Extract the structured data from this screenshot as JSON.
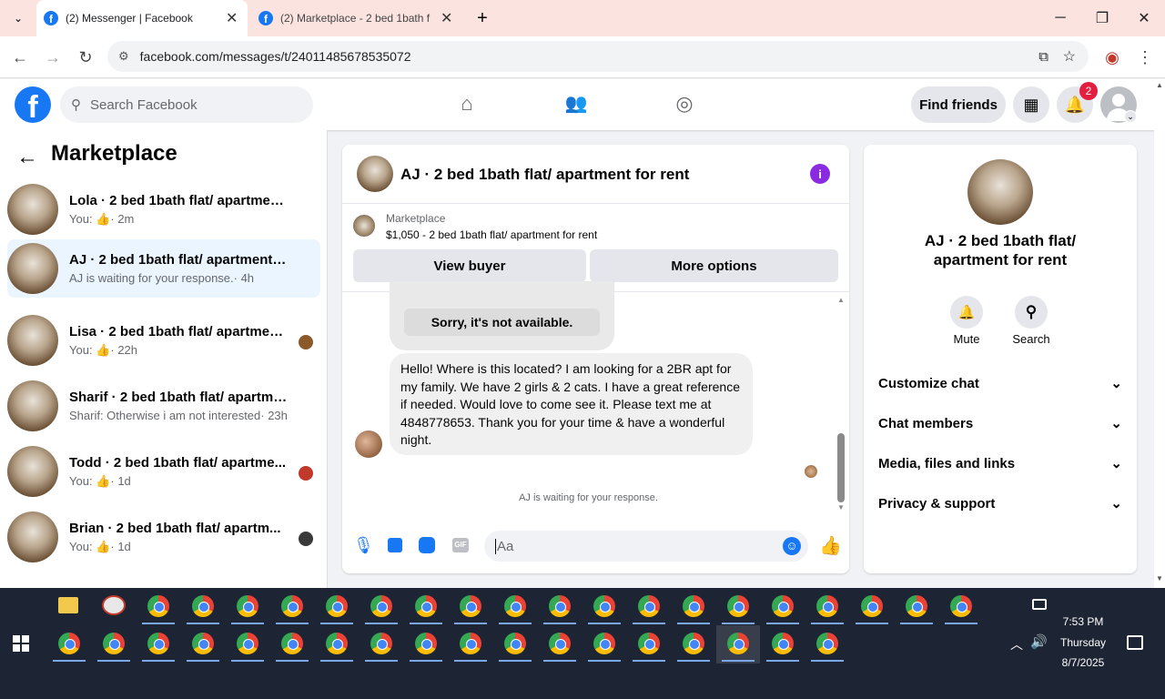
{
  "browser": {
    "tabs": [
      {
        "title": "(2) Messenger | Facebook"
      },
      {
        "title": "(2) Marketplace - 2 bed 1bath f"
      }
    ],
    "url": "facebook.com/messages/t/24011485678535072"
  },
  "fb": {
    "search_placeholder": "Search Facebook",
    "find_friends": "Find friends",
    "notif_count": "2"
  },
  "sidebar": {
    "title": "Marketplace",
    "conversations": [
      {
        "title": "Lola · 2 bed 1bath flat/ apartment ...",
        "prefix": "You:",
        "time": "· 2m"
      },
      {
        "title": "AJ · 2 bed 1bath flat/ apartment fo...",
        "prefix": "AJ is waiting for your response.",
        "time": "· 4h"
      },
      {
        "title": "Lisa · 2 bed 1bath flat/ apartmen...",
        "prefix": "You:",
        "time": "· 22h"
      },
      {
        "title": "Sharif · 2 bed 1bath flat/ apartmen...",
        "prefix": "Sharif: Otherwise i am not interested",
        "time": "· 23h"
      },
      {
        "title": "Todd · 2 bed 1bath flat/ apartme...",
        "prefix": "You:",
        "time": "· 1d"
      },
      {
        "title": "Brian · 2 bed 1bath flat/ apartm...",
        "prefix": "You:",
        "time": "· 1d"
      }
    ]
  },
  "chat": {
    "title": "AJ · 2 bed 1bath flat/ apartment for rent",
    "listing_source": "Marketplace",
    "listing_title": "$1,050 - 2 bed 1bath flat/ apartment for rent",
    "view_buyer": "View buyer",
    "more_options": "More options",
    "reply_option": "Sorry, it's not available.",
    "message": "Hello! Where is this located? I am looking for a 2BR apt for my family. We have 2 girls & 2 cats. I have a great reference if needed. Would love to come see it. Please text me at 4848778653. Thank you for your time & have a wonderful night.",
    "waiting": "AJ is waiting for your response.",
    "input_placeholder": "Aa"
  },
  "right_panel": {
    "title": "AJ · 2 bed 1bath flat/ apartment for rent",
    "mute": "Mute",
    "search": "Search",
    "sections": [
      "Customize chat",
      "Chat members",
      "Media, files and links",
      "Privacy & support"
    ]
  },
  "taskbar": {
    "time": "7:53 PM",
    "day": "Thursday",
    "date": "8/7/2025"
  },
  "colors": {
    "fb_blue": "#1877f2",
    "messenger_purple": "#8a2be2"
  }
}
